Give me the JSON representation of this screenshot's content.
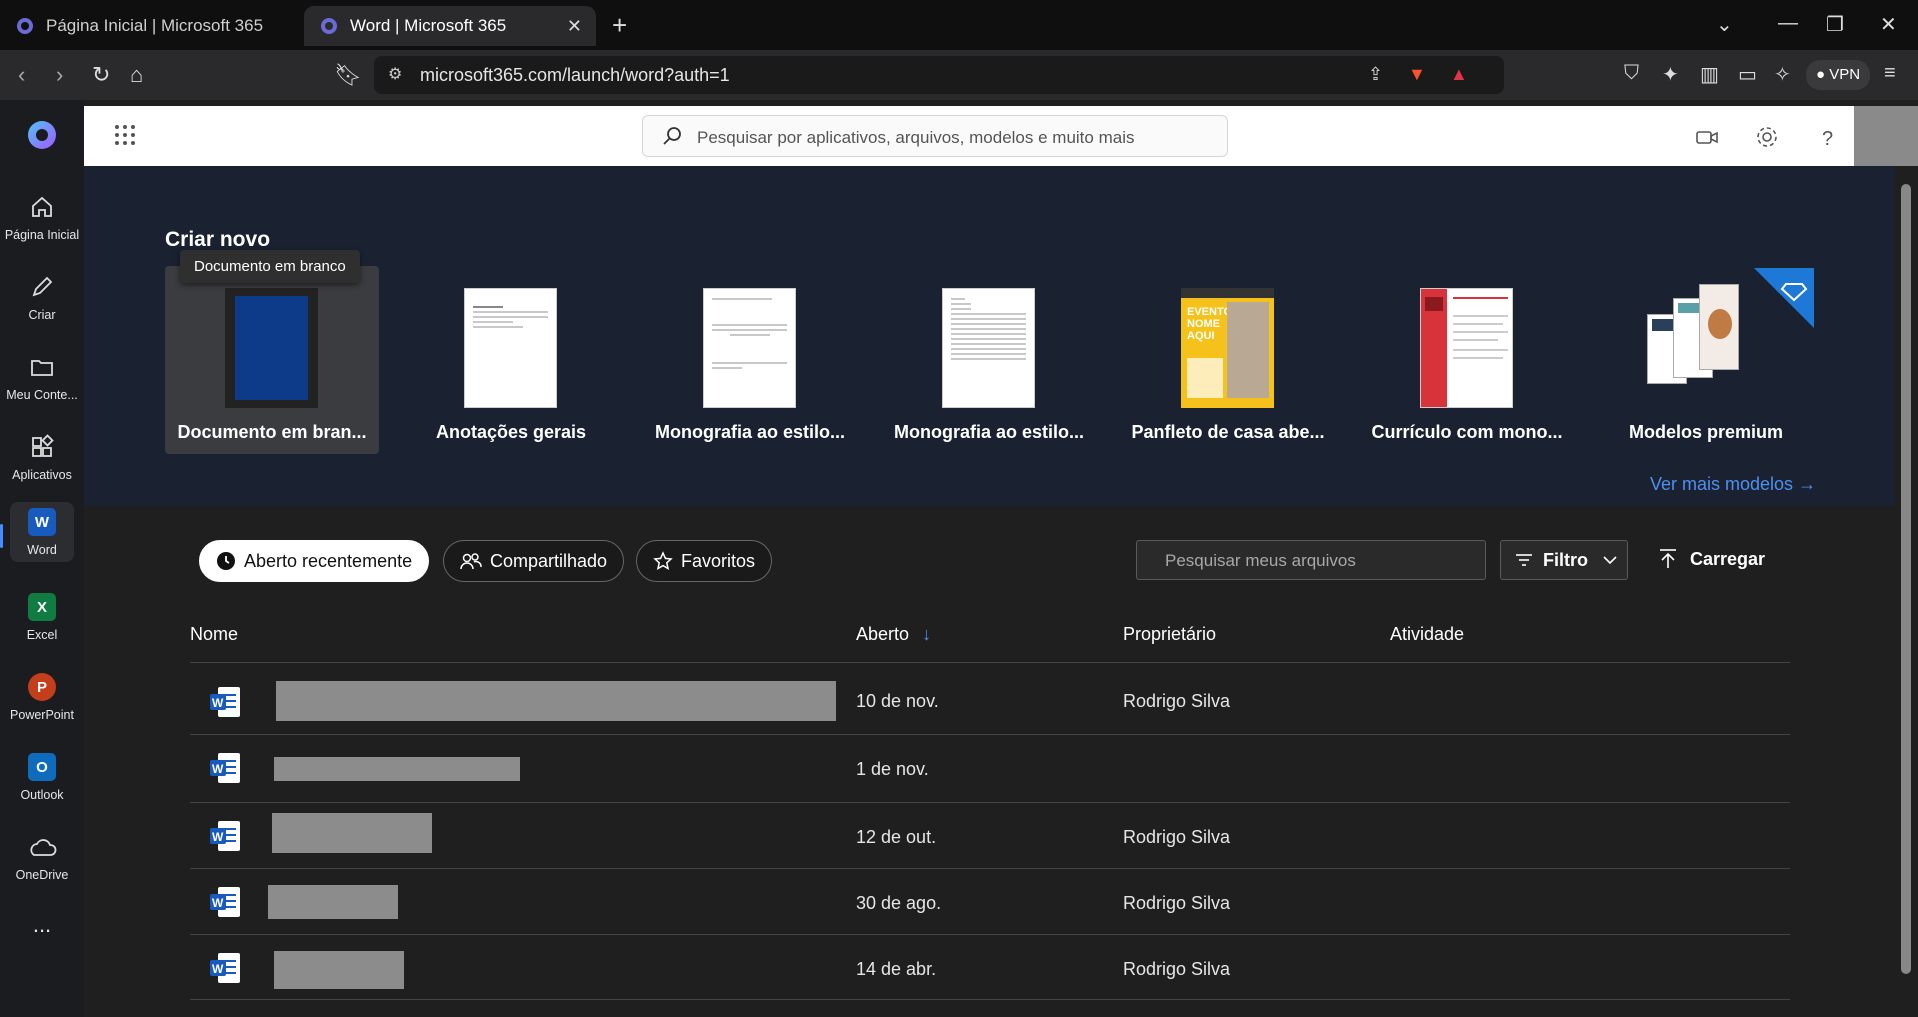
{
  "browser": {
    "tabs": [
      {
        "title": "Página Inicial | Microsoft 365",
        "active": false
      },
      {
        "title": "Word | Microsoft 365",
        "active": true
      }
    ],
    "url": "microsoft365.com/launch/word?auth=1",
    "vpn_label": "VPN"
  },
  "rail": {
    "items": [
      {
        "label": "Página Inicial",
        "icon": "home-icon"
      },
      {
        "label": "Criar",
        "icon": "pencil-icon"
      },
      {
        "label": "Meu Conte...",
        "icon": "folder-icon"
      },
      {
        "label": "Aplicativos",
        "icon": "apps-icon"
      },
      {
        "label": "Word",
        "icon": "word-icon"
      },
      {
        "label": "Excel",
        "icon": "excel-icon"
      },
      {
        "label": "PowerPoint",
        "icon": "powerpoint-icon"
      },
      {
        "label": "Outlook",
        "icon": "outlook-icon"
      },
      {
        "label": "OneDrive",
        "icon": "cloud-icon"
      }
    ],
    "more": "..."
  },
  "header": {
    "search_placeholder": "Pesquisar por aplicativos, arquivos, modelos e muito mais"
  },
  "create": {
    "title": "Criar novo",
    "tooltip": "Documento em branco",
    "templates": [
      {
        "label": "Documento em bran..."
      },
      {
        "label": "Anotações gerais"
      },
      {
        "label": "Monografia ao estilo..."
      },
      {
        "label": "Monografia ao estilo..."
      },
      {
        "label": "Panfleto de casa abe..."
      },
      {
        "label": "Currículo com mono..."
      },
      {
        "label": "Modelos premium"
      }
    ],
    "flyer_text": "EVENTO NOME AQUI",
    "more_link": "Ver mais modelos"
  },
  "files": {
    "tabs": {
      "recent": "Aberto recentemente",
      "shared": "Compartilhado",
      "favorites": "Favoritos"
    },
    "search_placeholder": "Pesquisar meus arquivos",
    "filter_label": "Filtro",
    "upload_label": "Carregar",
    "columns": {
      "name": "Nome",
      "opened": "Aberto",
      "owner": "Proprietário",
      "activity": "Atividade"
    },
    "rows": [
      {
        "opened": "10 de nov.",
        "owner": "Rodrigo Silva"
      },
      {
        "opened": "1 de nov.",
        "owner": ""
      },
      {
        "opened": "12 de out.",
        "owner": "Rodrigo Silva"
      },
      {
        "opened": "30 de ago.",
        "owner": "Rodrigo Silva"
      },
      {
        "opened": "14 de abr.",
        "owner": "Rodrigo Silva"
      }
    ]
  },
  "colors": {
    "accent": "#4f8ff0",
    "word_blue": "#185abd",
    "excel_green": "#107c41",
    "ppt_orange": "#c43e1c",
    "outlook_blue": "#0f6cbd"
  }
}
